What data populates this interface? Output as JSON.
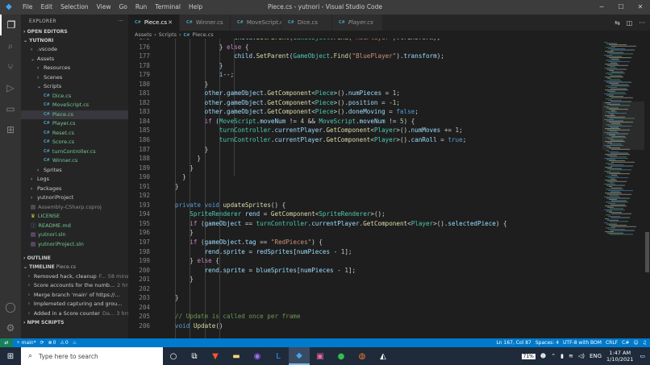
{
  "window": {
    "title": "Piece.cs - yutnori - Visual Studio Code",
    "menu": [
      "File",
      "Edit",
      "Selection",
      "View",
      "Go",
      "Run",
      "Terminal",
      "Help"
    ]
  },
  "sidebar": {
    "header": "EXPLORER",
    "open_editors": "OPEN EDITORS",
    "project": "YUTNORI",
    "tree": [
      {
        "label": ".vscode",
        "depth": 1,
        "kind": "folder",
        "open": false
      },
      {
        "label": "Assets",
        "depth": 1,
        "kind": "folder",
        "open": true
      },
      {
        "label": "Resources",
        "depth": 2,
        "kind": "folder",
        "open": false
      },
      {
        "label": "Scenes",
        "depth": 2,
        "kind": "folder",
        "open": false
      },
      {
        "label": "Scripts",
        "depth": 2,
        "kind": "folder",
        "open": true
      },
      {
        "label": "Dice.cs",
        "depth": 3,
        "kind": "cs"
      },
      {
        "label": "MoveScript.cs",
        "depth": 3,
        "kind": "cs"
      },
      {
        "label": "Piece.cs",
        "depth": 3,
        "kind": "cs",
        "selected": true
      },
      {
        "label": "Player.cs",
        "depth": 3,
        "kind": "cs"
      },
      {
        "label": "Reset.cs",
        "depth": 3,
        "kind": "cs"
      },
      {
        "label": "Score.cs",
        "depth": 3,
        "kind": "cs"
      },
      {
        "label": "turnController.cs",
        "depth": 3,
        "kind": "cs"
      },
      {
        "label": "Winner.cs",
        "depth": 3,
        "kind": "cs"
      },
      {
        "label": "Sprites",
        "depth": 2,
        "kind": "folder",
        "open": false
      },
      {
        "label": "Logs",
        "depth": 1,
        "kind": "folder",
        "open": false
      },
      {
        "label": "Packages",
        "depth": 1,
        "kind": "folder",
        "open": false
      },
      {
        "label": "yutnoriProject",
        "depth": 1,
        "kind": "folder",
        "open": false
      },
      {
        "label": "Assembly-CSharp.csproj",
        "depth": 1,
        "kind": "csproj"
      },
      {
        "label": "LICENSE",
        "depth": 1,
        "kind": "license"
      },
      {
        "label": "README.md",
        "depth": 1,
        "kind": "md"
      },
      {
        "label": "yutnori.sln",
        "depth": 1,
        "kind": "sln"
      },
      {
        "label": "yutnoriProject.sln",
        "depth": 1,
        "kind": "sln"
      }
    ],
    "outline": "OUTLINE",
    "timeline": "TIMELINE",
    "timeline_file": "Piece.cs",
    "timeline_items": [
      {
        "msg": "Removed hack, cleanup",
        "who": "F...",
        "time": "58 mins"
      },
      {
        "msg": "Score accounts for the numb...",
        "who": "",
        "time": "2 hrs"
      },
      {
        "msg": "Merge branch 'main' of https://...",
        "who": "",
        "time": ""
      },
      {
        "msg": "Implemeted capturing and grou...",
        "who": "",
        "time": ""
      },
      {
        "msg": "Added in a Score counter",
        "who": "Da...",
        "time": "3 hrs"
      }
    ],
    "npm": "NPM SCRIPTS"
  },
  "tabs": [
    {
      "label": "Piece.cs",
      "active": true,
      "italic": false
    },
    {
      "label": "Winner.cs",
      "active": false,
      "italic": false
    },
    {
      "label": "MoveScript.cs",
      "active": false,
      "italic": false
    },
    {
      "label": "Dice.cs",
      "active": false,
      "italic": false
    },
    {
      "label": "Player.cs",
      "active": false,
      "italic": true
    }
  ],
  "breadcrumb": [
    "Assets",
    "Scripts",
    "Piece.cs"
  ],
  "editor": {
    "first_line": 175,
    "lines": [
      [
        [
          "                ",
          ""
        ],
        [
          "child",
          "var"
        ],
        [
          ".",
          ""
        ],
        [
          "SetParent",
          "fn"
        ],
        [
          "(",
          ""
        ],
        [
          "GameObject",
          "ty"
        ],
        [
          ".",
          ""
        ],
        [
          "Find",
          "fn"
        ],
        [
          "(",
          ""
        ],
        [
          "\"RedPlayer\"",
          "str"
        ],
        [
          ").transform);",
          ""
        ]
      ],
      [
        [
          "            } ",
          ""
        ],
        [
          "else",
          "ctl"
        ],
        [
          " {",
          ""
        ]
      ],
      [
        [
          "                ",
          ""
        ],
        [
          "child",
          "var"
        ],
        [
          ".",
          ""
        ],
        [
          "SetParent",
          "fn"
        ],
        [
          "(",
          ""
        ],
        [
          "GameObject",
          "ty"
        ],
        [
          ".",
          ""
        ],
        [
          "Find",
          "fn"
        ],
        [
          "(",
          ""
        ],
        [
          "\"BluePlayer\"",
          "str"
        ],
        [
          ").",
          ""
        ],
        [
          "transform",
          "var"
        ],
        [
          ");",
          ""
        ]
      ],
      [
        [
          "            }",
          ""
        ]
      ],
      [
        [
          "            ",
          ""
        ],
        [
          "i",
          "var"
        ],
        [
          "--;",
          ""
        ]
      ],
      [
        [
          "        }",
          ""
        ]
      ],
      [
        [
          "        ",
          ""
        ],
        [
          "other",
          "var"
        ],
        [
          ".",
          ""
        ],
        [
          "gameObject",
          "var"
        ],
        [
          ".",
          ""
        ],
        [
          "GetComponent",
          "fn"
        ],
        [
          "<",
          ""
        ],
        [
          "Piece",
          "ty"
        ],
        [
          ">().",
          ""
        ],
        [
          "numPieces",
          "var"
        ],
        [
          " = ",
          ""
        ],
        [
          "1",
          "num"
        ],
        [
          ";",
          ""
        ]
      ],
      [
        [
          "        ",
          ""
        ],
        [
          "other",
          "var"
        ],
        [
          ".",
          ""
        ],
        [
          "gameObject",
          "var"
        ],
        [
          ".",
          ""
        ],
        [
          "GetComponent",
          "fn"
        ],
        [
          "<",
          ""
        ],
        [
          "Piece",
          "ty"
        ],
        [
          ">().",
          ""
        ],
        [
          "position",
          "var"
        ],
        [
          " = -",
          ""
        ],
        [
          "1",
          "num"
        ],
        [
          ";",
          ""
        ]
      ],
      [
        [
          "        ",
          ""
        ],
        [
          "other",
          "var"
        ],
        [
          ".",
          ""
        ],
        [
          "gameObject",
          "var"
        ],
        [
          ".",
          ""
        ],
        [
          "GetComponent",
          "fn"
        ],
        [
          "<",
          ""
        ],
        [
          "Piece",
          "ty"
        ],
        [
          ">().",
          ""
        ],
        [
          "doneMoving",
          "var"
        ],
        [
          " = ",
          ""
        ],
        [
          "false",
          "kw"
        ],
        [
          ";",
          ""
        ]
      ],
      [
        [
          "        ",
          ""
        ],
        [
          "if",
          "ctl"
        ],
        [
          " (",
          ""
        ],
        [
          "MoveScript",
          "ty"
        ],
        [
          ".",
          ""
        ],
        [
          "moveNum",
          "var"
        ],
        [
          " != ",
          ""
        ],
        [
          "4",
          "num"
        ],
        [
          " && ",
          ""
        ],
        [
          "MoveScript",
          "ty"
        ],
        [
          ".",
          ""
        ],
        [
          "moveNum",
          "var"
        ],
        [
          " != ",
          ""
        ],
        [
          "5",
          "num"
        ],
        [
          ") {",
          ""
        ]
      ],
      [
        [
          "            ",
          ""
        ],
        [
          "turnController",
          "ty"
        ],
        [
          ".",
          ""
        ],
        [
          "currentPlayer",
          "var"
        ],
        [
          ".",
          ""
        ],
        [
          "GetComponent",
          "fn"
        ],
        [
          "<",
          ""
        ],
        [
          "Player",
          "ty"
        ],
        [
          ">().",
          ""
        ],
        [
          "numMoves",
          "var"
        ],
        [
          " += ",
          ""
        ],
        [
          "1",
          "num"
        ],
        [
          ";",
          ""
        ]
      ],
      [
        [
          "            ",
          ""
        ],
        [
          "turnController",
          "ty"
        ],
        [
          ".",
          ""
        ],
        [
          "currentPlayer",
          "var"
        ],
        [
          ".",
          ""
        ],
        [
          "GetComponent",
          "fn"
        ],
        [
          "<",
          ""
        ],
        [
          "Player",
          "ty"
        ],
        [
          ">().",
          ""
        ],
        [
          "canRoll",
          "var"
        ],
        [
          " = ",
          ""
        ],
        [
          "true",
          "kw"
        ],
        [
          ";",
          ""
        ]
      ],
      [
        [
          "        }",
          ""
        ]
      ],
      [
        [
          "      }",
          ""
        ]
      ],
      [
        [
          "    }",
          ""
        ]
      ],
      [
        [
          "  }",
          ""
        ]
      ],
      [
        [
          "}",
          ""
        ]
      ],
      [
        [
          "",
          ""
        ]
      ],
      [
        [
          "private",
          "kw"
        ],
        [
          " ",
          ""
        ],
        [
          "void",
          "kw"
        ],
        [
          " ",
          ""
        ],
        [
          "updateSprites",
          "fn"
        ],
        [
          "() {",
          ""
        ]
      ],
      [
        [
          "    ",
          ""
        ],
        [
          "SpriteRenderer",
          "ty"
        ],
        [
          " ",
          ""
        ],
        [
          "rend",
          "var"
        ],
        [
          " = ",
          ""
        ],
        [
          "GetComponent",
          "fn"
        ],
        [
          "<",
          ""
        ],
        [
          "SpriteRenderer",
          "ty"
        ],
        [
          ">();",
          ""
        ]
      ],
      [
        [
          "    ",
          ""
        ],
        [
          "if",
          "ctl"
        ],
        [
          " (",
          ""
        ],
        [
          "gameObject",
          "var"
        ],
        [
          " == ",
          ""
        ],
        [
          "turnController",
          "ty"
        ],
        [
          ".",
          ""
        ],
        [
          "currentPlayer",
          "var"
        ],
        [
          ".",
          ""
        ],
        [
          "GetComponent",
          "fn"
        ],
        [
          "<",
          ""
        ],
        [
          "Player",
          "ty"
        ],
        [
          ">().",
          ""
        ],
        [
          "selectedPiece",
          "var"
        ],
        [
          ") {",
          ""
        ]
      ],
      [
        [
          "    }",
          ""
        ]
      ],
      [
        [
          "    ",
          ""
        ],
        [
          "if",
          "ctl"
        ],
        [
          " (",
          ""
        ],
        [
          "gameObject",
          "var"
        ],
        [
          ".",
          ""
        ],
        [
          "tag",
          "var"
        ],
        [
          " == ",
          ""
        ],
        [
          "\"RedPieces\"",
          "str"
        ],
        [
          ") {",
          ""
        ]
      ],
      [
        [
          "        ",
          ""
        ],
        [
          "rend",
          "var"
        ],
        [
          ".",
          ""
        ],
        [
          "sprite",
          "var"
        ],
        [
          " = ",
          ""
        ],
        [
          "redSprites",
          "var"
        ],
        [
          "[",
          ""
        ],
        [
          "numPieces",
          "var"
        ],
        [
          " - ",
          ""
        ],
        [
          "1",
          "num"
        ],
        [
          "];",
          ""
        ]
      ],
      [
        [
          "    } ",
          ""
        ],
        [
          "else",
          "ctl"
        ],
        [
          " {",
          ""
        ]
      ],
      [
        [
          "        ",
          ""
        ],
        [
          "rend",
          "var"
        ],
        [
          ".",
          ""
        ],
        [
          "sprite",
          "var"
        ],
        [
          " = ",
          ""
        ],
        [
          "blueSprites",
          "var"
        ],
        [
          "[",
          ""
        ],
        [
          "numPieces",
          "var"
        ],
        [
          " - ",
          ""
        ],
        [
          "1",
          "num"
        ],
        [
          "];",
          ""
        ]
      ],
      [
        [
          "    }",
          ""
        ]
      ],
      [
        [
          "",
          ""
        ]
      ],
      [
        [
          "}",
          ""
        ]
      ],
      [
        [
          "",
          ""
        ]
      ],
      [
        [
          "// Update is called once per frame",
          "cm"
        ]
      ],
      [
        [
          "void",
          "kw"
        ],
        [
          " ",
          ""
        ],
        [
          "Update",
          "fn"
        ],
        [
          "()",
          ""
        ]
      ]
    ]
  },
  "status": {
    "branch": "main*",
    "sync": "",
    "problems": "0",
    "warnings": "0",
    "position": "Ln 167, Col 87",
    "spaces": "Spaces: 4",
    "encoding": "UTF-8 with BOM",
    "eol": "CRLF",
    "lang": "C#"
  },
  "taskbar": {
    "search_placeholder": "Type here to search",
    "battery": "71%",
    "lang": "ENG",
    "time": "1:47 AM",
    "date": "1/10/2021"
  },
  "colors": {
    "accent": "#007acc",
    "remote": "#16825d",
    "activity": "#333333",
    "sidebar": "#252526",
    "editor": "#1e1e1e"
  }
}
